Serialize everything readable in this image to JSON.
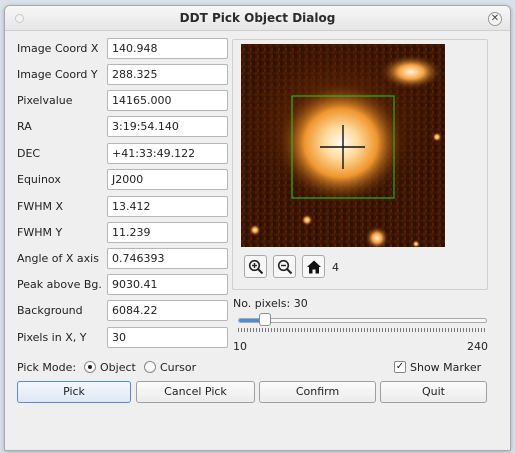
{
  "window": {
    "title": "DDT Pick Object Dialog"
  },
  "fields": [
    {
      "label": "Image Coord X",
      "value": "140.948"
    },
    {
      "label": "Image Coord Y",
      "value": "288.325"
    },
    {
      "label": "Pixelvalue",
      "value": "14165.000"
    },
    {
      "label": "RA",
      "value": "3:19:54.140"
    },
    {
      "label": "DEC",
      "value": "+41:33:49.122"
    },
    {
      "label": "Equinox",
      "value": "J2000"
    },
    {
      "label": "FWHM X",
      "value": "13.412"
    },
    {
      "label": "FWHM Y",
      "value": "11.239"
    },
    {
      "label": "Angle of X axis",
      "value": "0.746393"
    },
    {
      "label": "Peak above Bg.",
      "value": "9030.41"
    },
    {
      "label": "Background",
      "value": "6084.22"
    },
    {
      "label": "Pixels in X, Y",
      "value": "30"
    }
  ],
  "toolbar": {
    "zoom_in_icon": "zoom-in-icon",
    "zoom_out_icon": "zoom-out-icon",
    "home_icon": "home-icon",
    "zoom_level": "4"
  },
  "slider": {
    "label": "No. pixels: 30",
    "min_label": "10",
    "max_label": "240",
    "min": 10,
    "max": 240,
    "value": 30
  },
  "pick_mode": {
    "label": "Pick Mode:",
    "options": [
      {
        "label": "Object",
        "selected": true
      },
      {
        "label": "Cursor",
        "selected": false
      }
    ]
  },
  "show_marker": {
    "label": "Show Marker",
    "checked": true
  },
  "buttons": {
    "pick": "Pick",
    "cancel_pick": "Cancel Pick",
    "confirm": "Confirm",
    "quit": "Quit"
  },
  "colors": {
    "image_background": "#3a1400",
    "star_core": "#fff6e8",
    "star_halo": "#e88a2a",
    "marker_box": "#22cc22",
    "slider_fill": "#4a8fd6"
  }
}
